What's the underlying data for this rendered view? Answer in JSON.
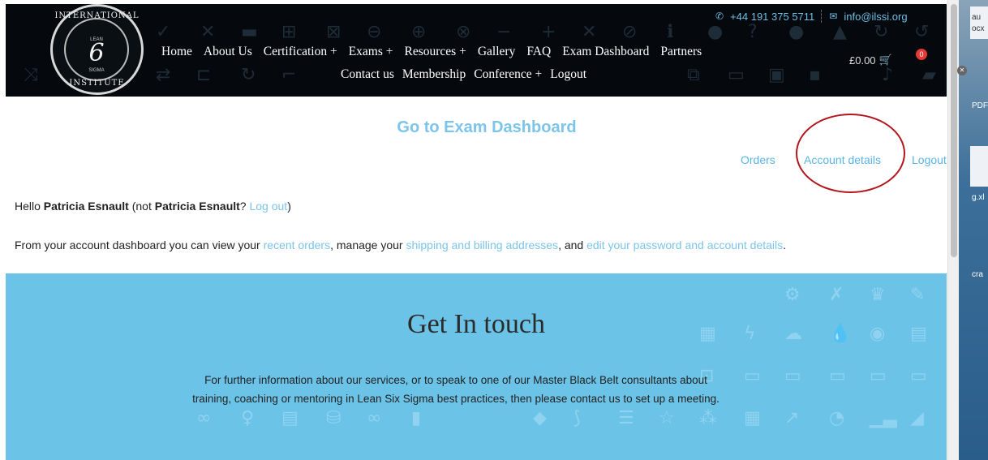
{
  "header": {
    "phone": "+44 191 375 5711",
    "email": "info@ilssi.org",
    "logo": {
      "top_text": "INTERNATIONAL",
      "bottom_text": "INSTITUTE",
      "lean": "LEAN",
      "six": "6",
      "sigma": "SIGMA"
    },
    "nav_row1": [
      "Home",
      "About Us",
      "Certification +",
      "Exams +",
      "Resources +",
      "Gallery",
      "FAQ",
      "Exam Dashboard",
      "Partners"
    ],
    "nav_row2": [
      "Contact us",
      "Membership",
      "Conference +",
      "Logout"
    ],
    "cart_total": "£0.00",
    "cart_count": "0"
  },
  "account": {
    "dashboard_link": "Go to Exam Dashboard",
    "nav": {
      "orders": "Orders",
      "account_details": "Account details",
      "logout": "Logout"
    },
    "hello": {
      "prefix": "Hello ",
      "name": "Patricia Esnault",
      "mid": " (not ",
      "name2": "Patricia Esnault",
      "q": "? ",
      "logout_link": "Log out",
      "suffix": ")"
    },
    "intro": {
      "p1": "From your account dashboard you can view your ",
      "l1": "recent orders",
      "p2": ", manage your ",
      "l2": "shipping and billing addresses",
      "p3": ", and ",
      "l3": "edit your password and account details",
      "p4": "."
    }
  },
  "contact": {
    "title": "Get In touch",
    "text": "For further information about our services, or to speak to one of our Master Black Belt consultants about training, coaching or mentoring in Lean Six Sigma best practices, then please contact us to set up a meeting."
  },
  "side": {
    "t1": "au",
    "t2": "ocx",
    "t3": "PDF",
    "t4": "g.xl",
    "t5": "cra"
  },
  "colors": {
    "accent": "#7cc4ea",
    "header_bg": "#05080c",
    "contact_bg": "#6cc3e8",
    "annotation": "#b2151b",
    "badge": "#e53935"
  }
}
